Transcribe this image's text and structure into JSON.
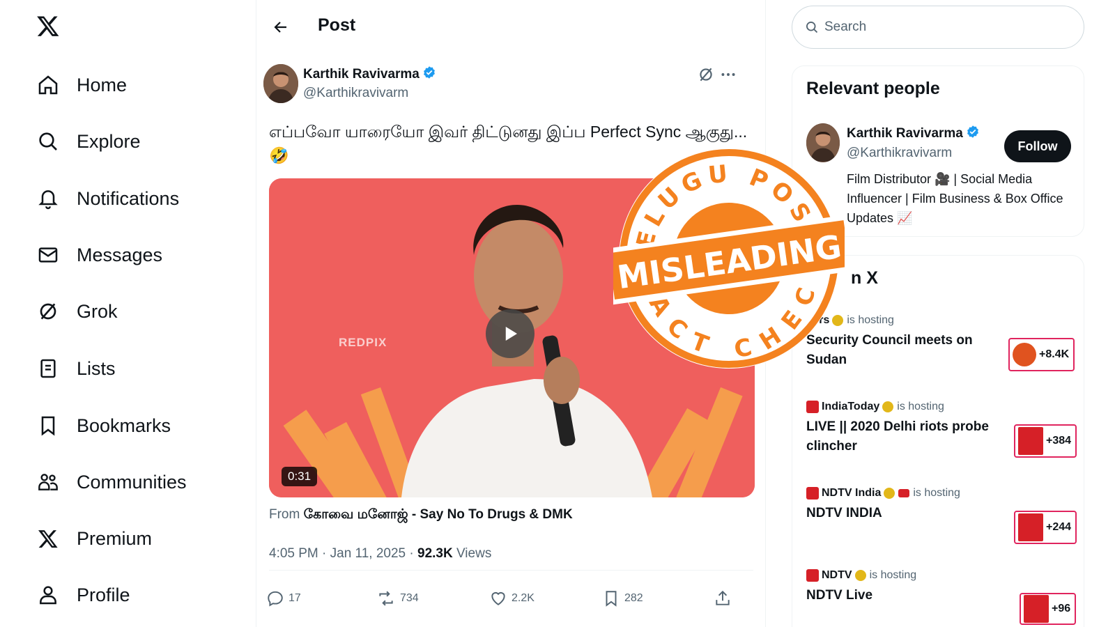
{
  "sidebar": {
    "logo_icon": "x-logo-icon",
    "items": [
      {
        "label": "Home",
        "icon": "home-icon"
      },
      {
        "label": "Explore",
        "icon": "search-icon"
      },
      {
        "label": "Notifications",
        "icon": "bell-icon"
      },
      {
        "label": "Messages",
        "icon": "envelope-icon"
      },
      {
        "label": "Grok",
        "icon": "grok-icon"
      },
      {
        "label": "Lists",
        "icon": "list-icon"
      },
      {
        "label": "Bookmarks",
        "icon": "bookmark-icon"
      },
      {
        "label": "Communities",
        "icon": "people-icon"
      },
      {
        "label": "Premium",
        "icon": "x-logo-icon"
      },
      {
        "label": "Profile",
        "icon": "person-icon"
      }
    ]
  },
  "header": {
    "title": "Post"
  },
  "post": {
    "author_name": "Karthik Ravivarma",
    "author_handle": "@Karthikravivarm",
    "text": "எப்பவோ யாரையோ இவர் திட்டுனது இப்ப Perfect Sync ஆகுது...",
    "emoji": "🤣",
    "video_duration": "0:31",
    "video_watermark": "REDPIX",
    "source_prefix": "From",
    "source_name": "கோவை மனோஜ் - Say No To Drugs & DMK",
    "timestamp": "4:05 PM · Jan 11, 2025 · ",
    "views_count": "92.3K",
    "views_label": " Views",
    "actions": {
      "replies": "17",
      "reposts": "734",
      "likes": "2.2K",
      "bookmarks": "282"
    }
  },
  "search": {
    "placeholder": "Search"
  },
  "relevant_people": {
    "title": "Relevant people",
    "name": "Karthik Ravivarma",
    "handle": "@Karthikravivarm",
    "follow_label": "Follow",
    "bio": "Film Distributor 🎥 | Social Media Influencer | Film Business & Box Office Updates 📈"
  },
  "live_on_x": {
    "title": "n X",
    "spaces": [
      {
        "host": "ters",
        "hosting_label": "is hosting",
        "title": "Security Council meets on Sudan",
        "listeners": "+8.4K"
      },
      {
        "host": "IndiaToday",
        "hosting_label": "is hosting",
        "title": "LIVE || 2020 Delhi riots probe clincher",
        "listeners": "+384"
      },
      {
        "host": "NDTV India",
        "hosting_label": "is hosting",
        "title": "NDTV INDIA",
        "listeners": "+244"
      },
      {
        "host": "NDTV",
        "hosting_label": "is hosting",
        "title": "NDTV Live",
        "listeners": "+96"
      }
    ]
  },
  "stamp": {
    "top_text": "TELUGU POST",
    "banner": "MISLEADING",
    "bottom_text": "FACT CHECK",
    "color": "#f4821f"
  },
  "colors": {
    "accent": "#1d9bf0",
    "text": "#0f1419",
    "muted": "#536471",
    "video_bg": "#ef5b5b",
    "stamp": "#f4821f"
  }
}
